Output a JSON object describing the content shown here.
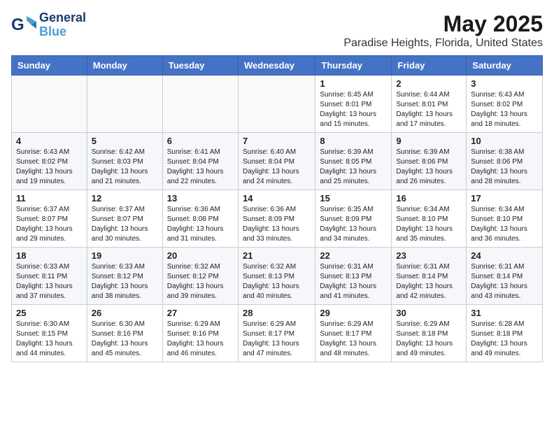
{
  "header": {
    "logo_general": "General",
    "logo_blue": "Blue",
    "month": "May 2025",
    "location": "Paradise Heights, Florida, United States"
  },
  "weekdays": [
    "Sunday",
    "Monday",
    "Tuesday",
    "Wednesday",
    "Thursday",
    "Friday",
    "Saturday"
  ],
  "weeks": [
    [
      {
        "day": "",
        "info": ""
      },
      {
        "day": "",
        "info": ""
      },
      {
        "day": "",
        "info": ""
      },
      {
        "day": "",
        "info": ""
      },
      {
        "day": "1",
        "info": "Sunrise: 6:45 AM\nSunset: 8:01 PM\nDaylight: 13 hours\nand 15 minutes."
      },
      {
        "day": "2",
        "info": "Sunrise: 6:44 AM\nSunset: 8:01 PM\nDaylight: 13 hours\nand 17 minutes."
      },
      {
        "day": "3",
        "info": "Sunrise: 6:43 AM\nSunset: 8:02 PM\nDaylight: 13 hours\nand 18 minutes."
      }
    ],
    [
      {
        "day": "4",
        "info": "Sunrise: 6:43 AM\nSunset: 8:02 PM\nDaylight: 13 hours\nand 19 minutes."
      },
      {
        "day": "5",
        "info": "Sunrise: 6:42 AM\nSunset: 8:03 PM\nDaylight: 13 hours\nand 21 minutes."
      },
      {
        "day": "6",
        "info": "Sunrise: 6:41 AM\nSunset: 8:04 PM\nDaylight: 13 hours\nand 22 minutes."
      },
      {
        "day": "7",
        "info": "Sunrise: 6:40 AM\nSunset: 8:04 PM\nDaylight: 13 hours\nand 24 minutes."
      },
      {
        "day": "8",
        "info": "Sunrise: 6:39 AM\nSunset: 8:05 PM\nDaylight: 13 hours\nand 25 minutes."
      },
      {
        "day": "9",
        "info": "Sunrise: 6:39 AM\nSunset: 8:06 PM\nDaylight: 13 hours\nand 26 minutes."
      },
      {
        "day": "10",
        "info": "Sunrise: 6:38 AM\nSunset: 8:06 PM\nDaylight: 13 hours\nand 28 minutes."
      }
    ],
    [
      {
        "day": "11",
        "info": "Sunrise: 6:37 AM\nSunset: 8:07 PM\nDaylight: 13 hours\nand 29 minutes."
      },
      {
        "day": "12",
        "info": "Sunrise: 6:37 AM\nSunset: 8:07 PM\nDaylight: 13 hours\nand 30 minutes."
      },
      {
        "day": "13",
        "info": "Sunrise: 6:36 AM\nSunset: 8:08 PM\nDaylight: 13 hours\nand 31 minutes."
      },
      {
        "day": "14",
        "info": "Sunrise: 6:36 AM\nSunset: 8:09 PM\nDaylight: 13 hours\nand 33 minutes."
      },
      {
        "day": "15",
        "info": "Sunrise: 6:35 AM\nSunset: 8:09 PM\nDaylight: 13 hours\nand 34 minutes."
      },
      {
        "day": "16",
        "info": "Sunrise: 6:34 AM\nSunset: 8:10 PM\nDaylight: 13 hours\nand 35 minutes."
      },
      {
        "day": "17",
        "info": "Sunrise: 6:34 AM\nSunset: 8:10 PM\nDaylight: 13 hours\nand 36 minutes."
      }
    ],
    [
      {
        "day": "18",
        "info": "Sunrise: 6:33 AM\nSunset: 8:11 PM\nDaylight: 13 hours\nand 37 minutes."
      },
      {
        "day": "19",
        "info": "Sunrise: 6:33 AM\nSunset: 8:12 PM\nDaylight: 13 hours\nand 38 minutes."
      },
      {
        "day": "20",
        "info": "Sunrise: 6:32 AM\nSunset: 8:12 PM\nDaylight: 13 hours\nand 39 minutes."
      },
      {
        "day": "21",
        "info": "Sunrise: 6:32 AM\nSunset: 8:13 PM\nDaylight: 13 hours\nand 40 minutes."
      },
      {
        "day": "22",
        "info": "Sunrise: 6:31 AM\nSunset: 8:13 PM\nDaylight: 13 hours\nand 41 minutes."
      },
      {
        "day": "23",
        "info": "Sunrise: 6:31 AM\nSunset: 8:14 PM\nDaylight: 13 hours\nand 42 minutes."
      },
      {
        "day": "24",
        "info": "Sunrise: 6:31 AM\nSunset: 8:14 PM\nDaylight: 13 hours\nand 43 minutes."
      }
    ],
    [
      {
        "day": "25",
        "info": "Sunrise: 6:30 AM\nSunset: 8:15 PM\nDaylight: 13 hours\nand 44 minutes."
      },
      {
        "day": "26",
        "info": "Sunrise: 6:30 AM\nSunset: 8:16 PM\nDaylight: 13 hours\nand 45 minutes."
      },
      {
        "day": "27",
        "info": "Sunrise: 6:29 AM\nSunset: 8:16 PM\nDaylight: 13 hours\nand 46 minutes."
      },
      {
        "day": "28",
        "info": "Sunrise: 6:29 AM\nSunset: 8:17 PM\nDaylight: 13 hours\nand 47 minutes."
      },
      {
        "day": "29",
        "info": "Sunrise: 6:29 AM\nSunset: 8:17 PM\nDaylight: 13 hours\nand 48 minutes."
      },
      {
        "day": "30",
        "info": "Sunrise: 6:29 AM\nSunset: 8:18 PM\nDaylight: 13 hours\nand 49 minutes."
      },
      {
        "day": "31",
        "info": "Sunrise: 6:28 AM\nSunset: 8:18 PM\nDaylight: 13 hours\nand 49 minutes."
      }
    ]
  ]
}
